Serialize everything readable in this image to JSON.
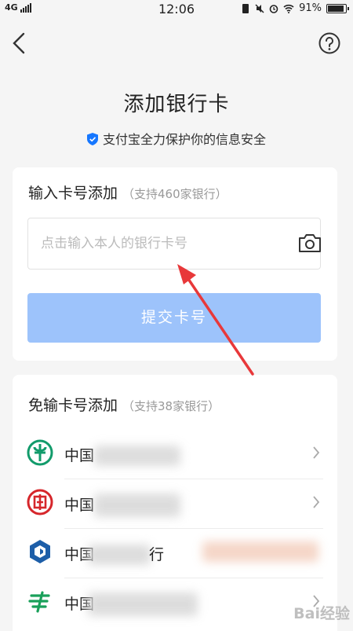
{
  "status_bar": {
    "network": "4G",
    "time": "12:06",
    "battery": "91%"
  },
  "page": {
    "title": "添加银行卡",
    "security_note": "支付宝全力保护你的信息安全"
  },
  "manual_add": {
    "title": "输入卡号添加",
    "subtitle": "（支持460家银行）",
    "input_placeholder": "点击输入本人的银行卡号",
    "submit_label": "提交卡号"
  },
  "quick_add": {
    "title": "免输卡号添加",
    "subtitle": "（支持38家银行）",
    "banks": [
      {
        "name": "中国",
        "logo": "abc-bank-icon",
        "color": "#129b6b"
      },
      {
        "name": "中国",
        "logo": "icbc-bank-icon",
        "color": "#d6262b"
      },
      {
        "name": "中国",
        "suffix": "行",
        "logo": "bocom-bank-icon",
        "color": "#1d5ea8"
      },
      {
        "name": "中国",
        "logo": "psbc-bank-icon",
        "color": "#19a05a"
      }
    ]
  },
  "watermark": "Bai经验",
  "colors": {
    "submit_disabled": "#9dc3fb",
    "arrow": "#e8383a",
    "shield": "#1677ff"
  }
}
